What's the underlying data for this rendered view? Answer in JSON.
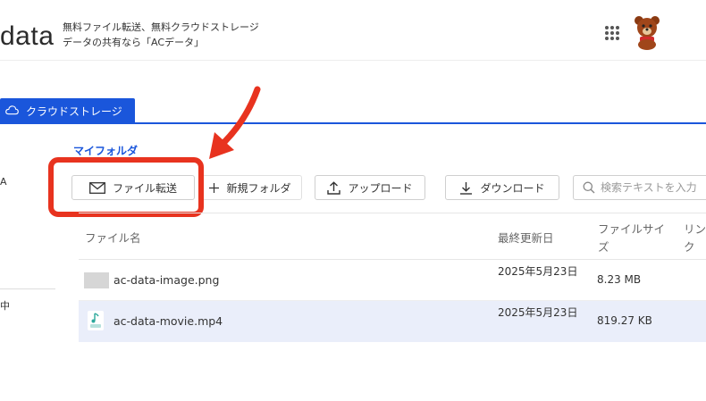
{
  "header": {
    "brand": "data",
    "tagline_line1": "無料ファイル転送、無料クラウドストレージ",
    "tagline_line2": "データの共有なら「ACデータ」",
    "apps_icon": "apps-grid-icon",
    "avatar_icon": "bear-avatar-icon"
  },
  "tab": {
    "label": "クラウドストレージ",
    "icon": "cloud-icon"
  },
  "sidebar": {
    "fragment_a": "A",
    "fragment_naka": "中"
  },
  "breadcrumb": "マイフォルダ",
  "toolbar": {
    "transfer": {
      "label": "ファイル転送",
      "icon": "mail-icon"
    },
    "new_folder": {
      "label": "新規フォルダ",
      "icon": "plus-icon"
    },
    "upload": {
      "label": "アップロード",
      "icon": "upload-icon"
    },
    "download": {
      "label": "ダウンロード",
      "icon": "download-icon"
    },
    "search_placeholder": "検索テキストを入力",
    "search_icon": "search-icon"
  },
  "annotation": {
    "color": "#e8331f"
  },
  "accent_color": "#1a56db",
  "table": {
    "columns": [
      "ファイル名",
      "最終更新日",
      "ファイルサイズ",
      "リンク"
    ],
    "rows": [
      {
        "name": "ac-data-image.png",
        "date": "2025年5月23日",
        "size": "8.23 MB",
        "icon": "image-file-icon"
      },
      {
        "name": "ac-data-movie.mp4",
        "date": "2025年5月23日",
        "size": "819.27 KB",
        "icon": "mp4-file-icon"
      }
    ]
  }
}
